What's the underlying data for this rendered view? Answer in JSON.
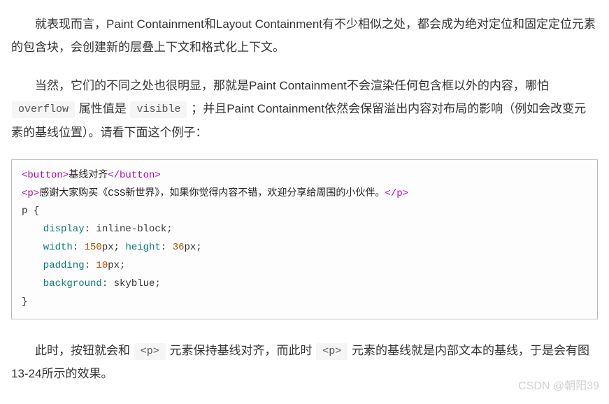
{
  "paragraphs": {
    "p1_a": "就表现而言，Paint Containment和Layout Containment有不少相似之处，都会成为绝对定位和固定定位元素的包含块，会创建新的层叠上下文和格式化上下文。",
    "p2_a": "当然，它们的不同之处也很明显，那就是Paint Containment不会渲染任何包含框以外的内容，哪怕 ",
    "p2_code1": "overflow",
    "p2_b": " 属性值是 ",
    "p2_code2": "visible",
    "p2_c": " ；并且Paint Containment依然会保留溢出内容对布局的影响（例如会改变元素的基线位置）。请看下面这个例子：",
    "p3_a": "此时，按钮就会和 ",
    "p3_code1": "<p>",
    "p3_b": " 元素保持基线对齐，而此时 ",
    "p3_code2": "<p>",
    "p3_c": " 元素的基线就是内部文本的基线，于是会有图13-24所示的效果。"
  },
  "code": {
    "line1": {
      "tag_open": "<button>",
      "text": "基线对齐",
      "tag_close": "</button>"
    },
    "line2": {
      "tag_open": "<p>",
      "text": "感谢大家购买《CSS新世界》，如果你觉得内容不错，欢迎分享给周围的小伙伴。",
      "tag_close": "</p>"
    },
    "line3": "p {",
    "line4": {
      "prop": "display",
      "colon": ": ",
      "val": "inline-block",
      "semi": ";"
    },
    "line5": {
      "prop": "width",
      "colon": ": ",
      "num1": "150",
      "unit1": "px;",
      "prop2": " height",
      "colon2": ": ",
      "num2": "36",
      "unit2": "px;"
    },
    "line6": {
      "prop": "padding",
      "colon": ": ",
      "num": "10",
      "unit": "px;"
    },
    "line7": {
      "prop": "background",
      "colon": ": ",
      "val": "skyblue",
      "semi": ";"
    },
    "line8": "}"
  },
  "watermark": "CSDN @朝阳39"
}
